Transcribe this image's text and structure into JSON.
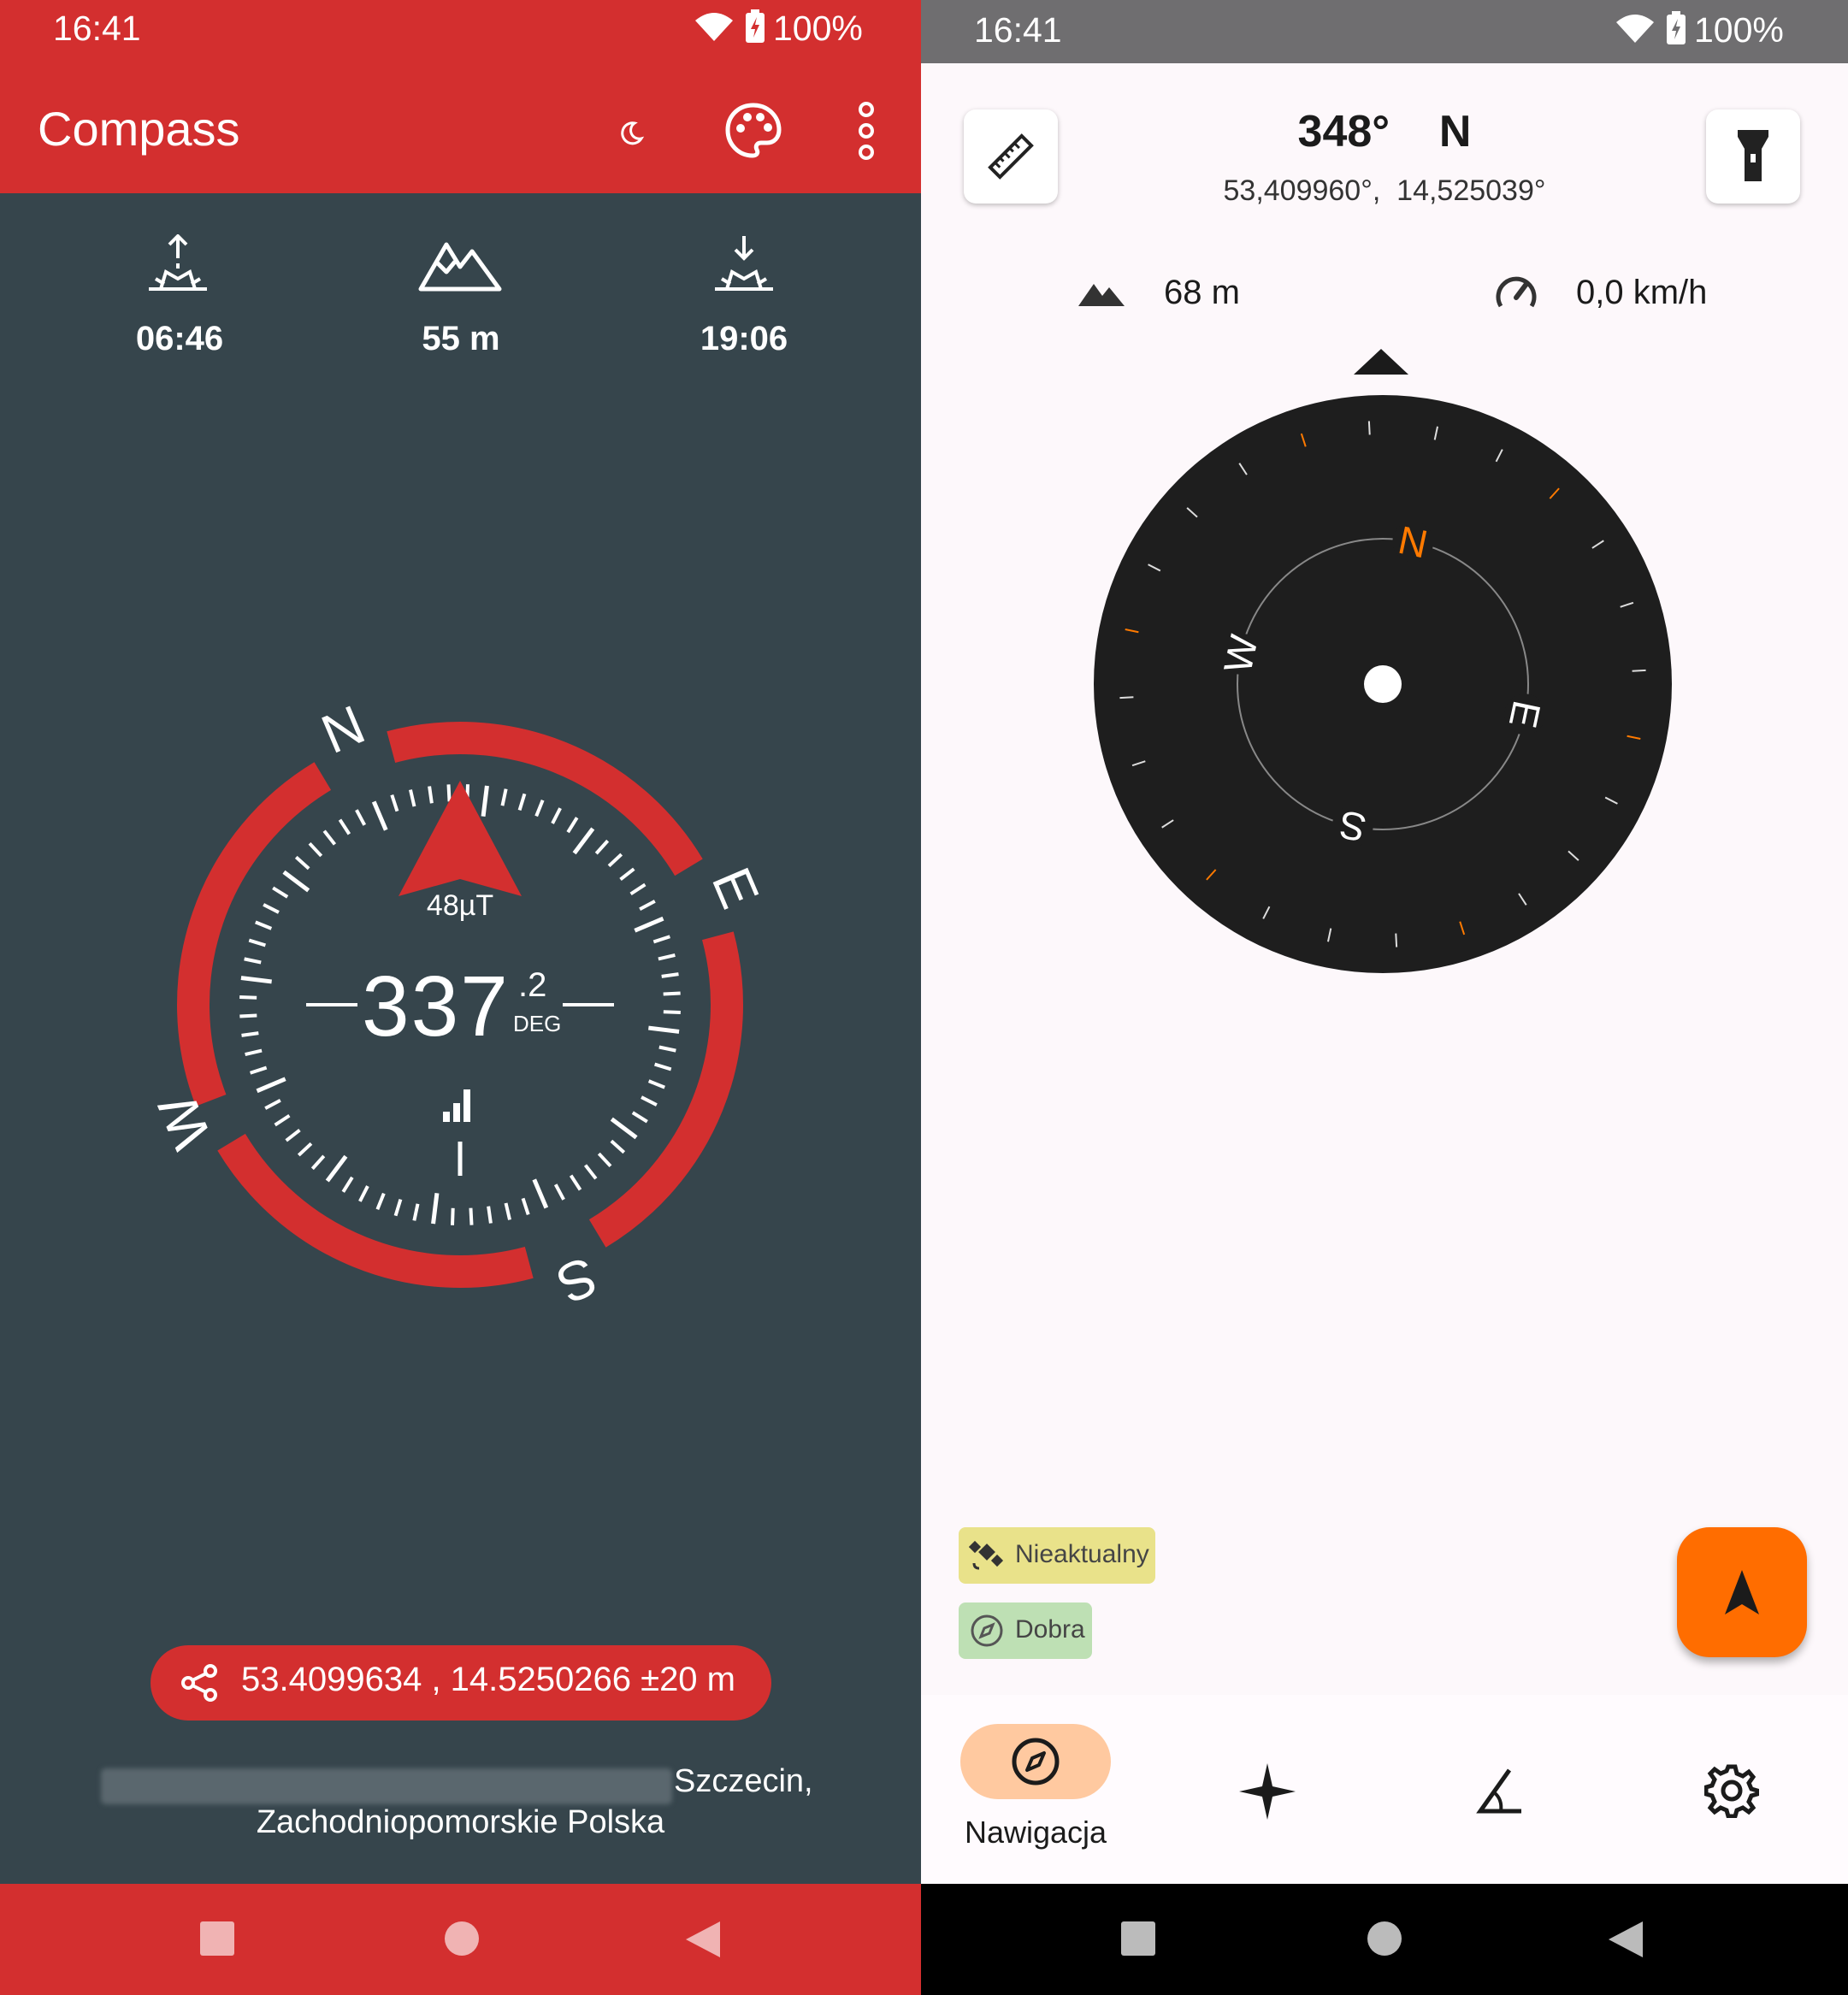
{
  "left": {
    "status": {
      "time": "16:41",
      "battery": "100%"
    },
    "appbar": {
      "title": "Compass",
      "icons": [
        "moon-icon",
        "palette-icon",
        "more-vert-icon"
      ]
    },
    "stats": {
      "sunrise": "06:46",
      "altitude": "55 m",
      "sunset": "19:06"
    },
    "compass": {
      "cardinals": {
        "n": "N",
        "e": "E",
        "s": "S",
        "w": "W"
      },
      "field_strength": "48µT",
      "heading_int": "337",
      "heading_dec": ".2",
      "heading_unit": "DEG",
      "accuracy_icon": "signal-bars-icon"
    },
    "location": {
      "coords": "53.4099634 , 14.5250266 ±20 m",
      "address_line1": "Szczecin,",
      "address_line2": "Zachodniopomorskie Polska"
    },
    "colors": {
      "accent": "#D32F2F",
      "background": "#36454C"
    }
  },
  "right": {
    "status": {
      "time": "16:41",
      "battery": "100%"
    },
    "header": {
      "heading": "348°",
      "direction": "N",
      "coordinates": "53,409960°,  14,525039°"
    },
    "info": {
      "altitude": "68 m",
      "speed": "0,0 km/h"
    },
    "dial": {
      "n": "N",
      "e": "E",
      "s": "S",
      "w": "W"
    },
    "chips": [
      {
        "label": "Nieaktualny",
        "icon": "satellite-icon",
        "color": "#E9E28A"
      },
      {
        "label": "Dobra",
        "icon": "compass-small-icon",
        "color": "#BEE0B4"
      }
    ],
    "bottom_nav": [
      {
        "label": "Nawigacja",
        "icon": "compass-icon",
        "selected": true
      },
      {
        "label": "",
        "icon": "star-icon",
        "selected": false
      },
      {
        "label": "",
        "icon": "angle-icon",
        "selected": false
      },
      {
        "label": "",
        "icon": "settings-icon",
        "selected": false
      }
    ],
    "colors": {
      "fab": "#FF6D00",
      "dial_accent": "#FF7A00",
      "nav_pill": "#FFC9A0"
    }
  }
}
